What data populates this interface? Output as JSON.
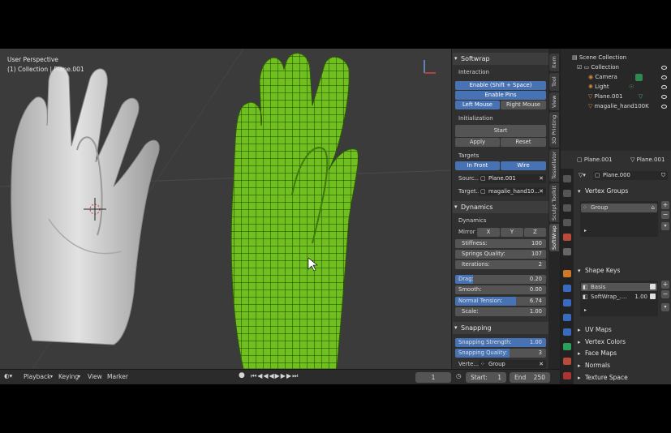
{
  "viewport": {
    "view_label": "User Perspective",
    "collection_label": "(1) Collection | Plane.001"
  },
  "timeline": {
    "playback": "Playback",
    "keying": "Keying",
    "view": "View",
    "marker": "Marker",
    "current_frame": "1",
    "start_label": "Start:",
    "start_value": "1",
    "end_label": "End",
    "end_value": "250"
  },
  "tabs": [
    "Item",
    "Tool",
    "View",
    "3D Printing",
    "Tessellator",
    "Sculpt Toolkit",
    "SoftWrap"
  ],
  "softwrap": {
    "title": "Softwrap",
    "interaction_label": "Interaction",
    "enable_btn": "Enable (Shift + Space)",
    "enable_pins_btn": "Enable Pins",
    "left_mouse_btn": "Left Mouse",
    "right_mouse_btn": "Right Mouse",
    "initialization_label": "Initialization",
    "start_btn": "Start",
    "apply_btn": "Apply",
    "reset_btn": "Reset",
    "targets_label": "Targets",
    "in_front_btn": "In Front",
    "wire_btn": "Wire",
    "source_label": "Sourc...",
    "source_value": "Plane.001",
    "target_label": "Target...",
    "target_value": "magalie_hand10..."
  },
  "dynamics": {
    "title": "Dynamics",
    "sub_label": "Dynamics",
    "mirror_label": "Mirror",
    "mirror_axes": [
      "X",
      "Y",
      "Z"
    ],
    "stiffness_label": "Stiffness:",
    "stiffness_value": "100",
    "springs_label": "Springs Quality:",
    "springs_value": "107",
    "iterations_label": "Iterations:",
    "iterations_value": "2",
    "drag_label": "Drag:",
    "drag_value": "0.20",
    "drag_fraction": 0.2,
    "smooth_label": "Smooth:",
    "smooth_value": "0.00",
    "normal_tension_label": "Normal Tension:",
    "normal_tension_value": "6.74",
    "normal_tension_fraction": 0.674,
    "scale_label": "Scale:",
    "scale_value": "1.00"
  },
  "snapping": {
    "title": "Snapping",
    "strength_label": "Snapping Strength:",
    "strength_value": "1.00",
    "strength_fraction": 1.0,
    "quality_label": "Snapping Quality:",
    "quality_value": "3",
    "quality_fraction": 0.6,
    "vertex_group_label": "Verte...",
    "vertex_group_value": "Group"
  },
  "outliner": {
    "scene_collection": "Scene Collection",
    "collection": "Collection",
    "items": [
      "Camera",
      "Light",
      "Plane.001",
      "magalie_hand100K"
    ]
  },
  "properties": {
    "object_name": "Plane.001",
    "data_name": "Plane.001",
    "mesh_name": "Plane.000",
    "vertex_groups_title": "Vertex Groups",
    "vertex_group_item": "Group",
    "shape_keys_title": "Shape Keys",
    "shape_keys": [
      {
        "name": "Basis",
        "value": ""
      },
      {
        "name": "SoftWrap_....",
        "value": "1.00"
      }
    ],
    "collapsed_sections": [
      "UV Maps",
      "Vertex Colors",
      "Face Maps",
      "Normals",
      "Texture Space"
    ]
  },
  "colors": {
    "accent_blue": "#4772b3",
    "mesh_green": "#6fbf1f",
    "hand_gray": "#d6d6d6"
  }
}
